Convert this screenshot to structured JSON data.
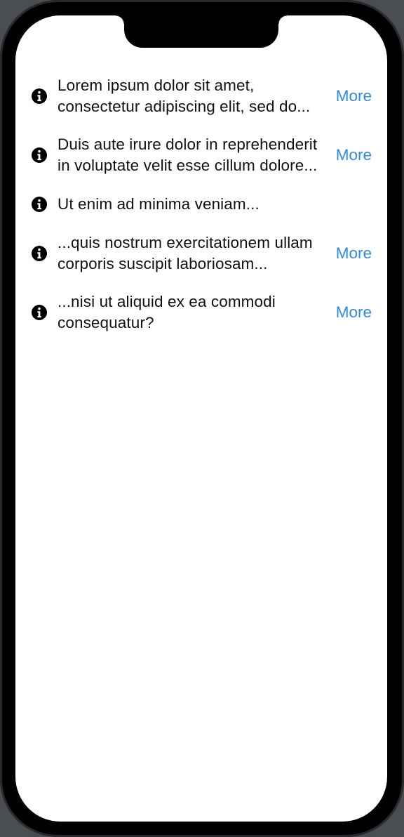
{
  "colors": {
    "link": "#2e8ae6",
    "text": "#111111",
    "icon": "#000000",
    "screen": "#ffffff"
  },
  "rows": [
    {
      "icon": "info-circle-icon",
      "lines": [
        "Lorem ipsum dolor sit amet,",
        "consectetur adipiscing elit, sed do..."
      ],
      "more_label": "More"
    },
    {
      "icon": "info-circle-icon",
      "lines": [
        "Duis aute irure dolor in reprehenderit",
        "in voluptate velit esse cillum dolore..."
      ],
      "more_label": "More"
    },
    {
      "icon": "info-circle-icon",
      "lines": [
        "Ut enim ad minima veniam..."
      ],
      "more_label": null
    },
    {
      "icon": "info-circle-icon",
      "lines": [
        "...quis nostrum exercitationem ullam",
        "corporis suscipit laboriosam..."
      ],
      "more_label": "More"
    },
    {
      "icon": "info-circle-icon",
      "lines": [
        "...nisi ut aliquid ex ea commodi",
        "consequatur?"
      ],
      "more_label": "More"
    }
  ]
}
